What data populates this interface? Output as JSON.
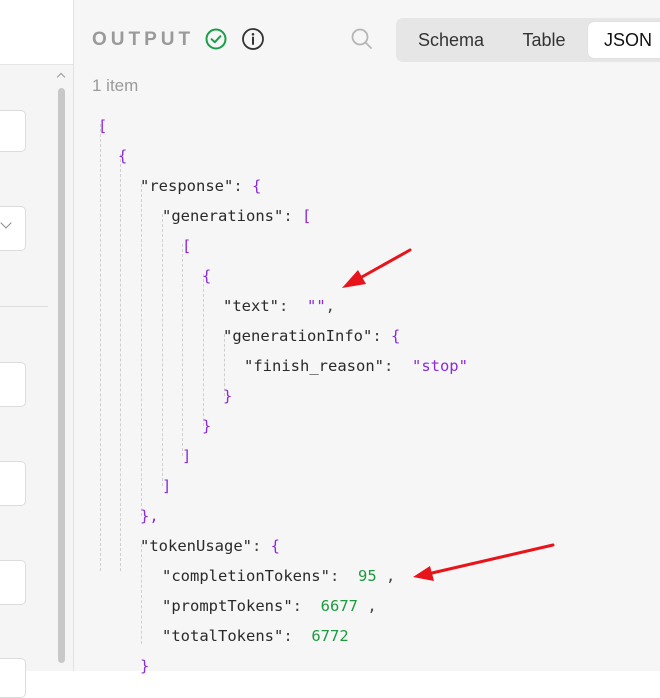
{
  "output": {
    "title": "OUTPUT",
    "item_count": "1 item",
    "tabs": [
      "Schema",
      "Table",
      "JSON"
    ],
    "active_tab": "JSON"
  },
  "json": {
    "open_array": "[",
    "open_obj": "{",
    "response_key": "\"response\"",
    "generations_key": "\"generations\"",
    "text_key": "\"text\"",
    "text_value": "\"\"",
    "generationInfo_key": "\"generationInfo\"",
    "finish_reason_key": "\"finish_reason\"",
    "finish_reason_value": "\"stop\"",
    "tokenUsage_key": "\"tokenUsage\"",
    "completionTokens_key": "\"completionTokens\"",
    "completionTokens_value": "95",
    "promptTokens_key": "\"promptTokens\"",
    "promptTokens_value": "6677",
    "totalTokens_key": "\"totalTokens\"",
    "totalTokens_value": "6772",
    "close_obj": "}",
    "close_array": "]",
    "close_obj_comma": "},"
  },
  "colors": {
    "bracket": "#8b2bd9",
    "number": "#1d9a3f",
    "arrow": "#e8141b",
    "success": "#1a9e4a"
  }
}
